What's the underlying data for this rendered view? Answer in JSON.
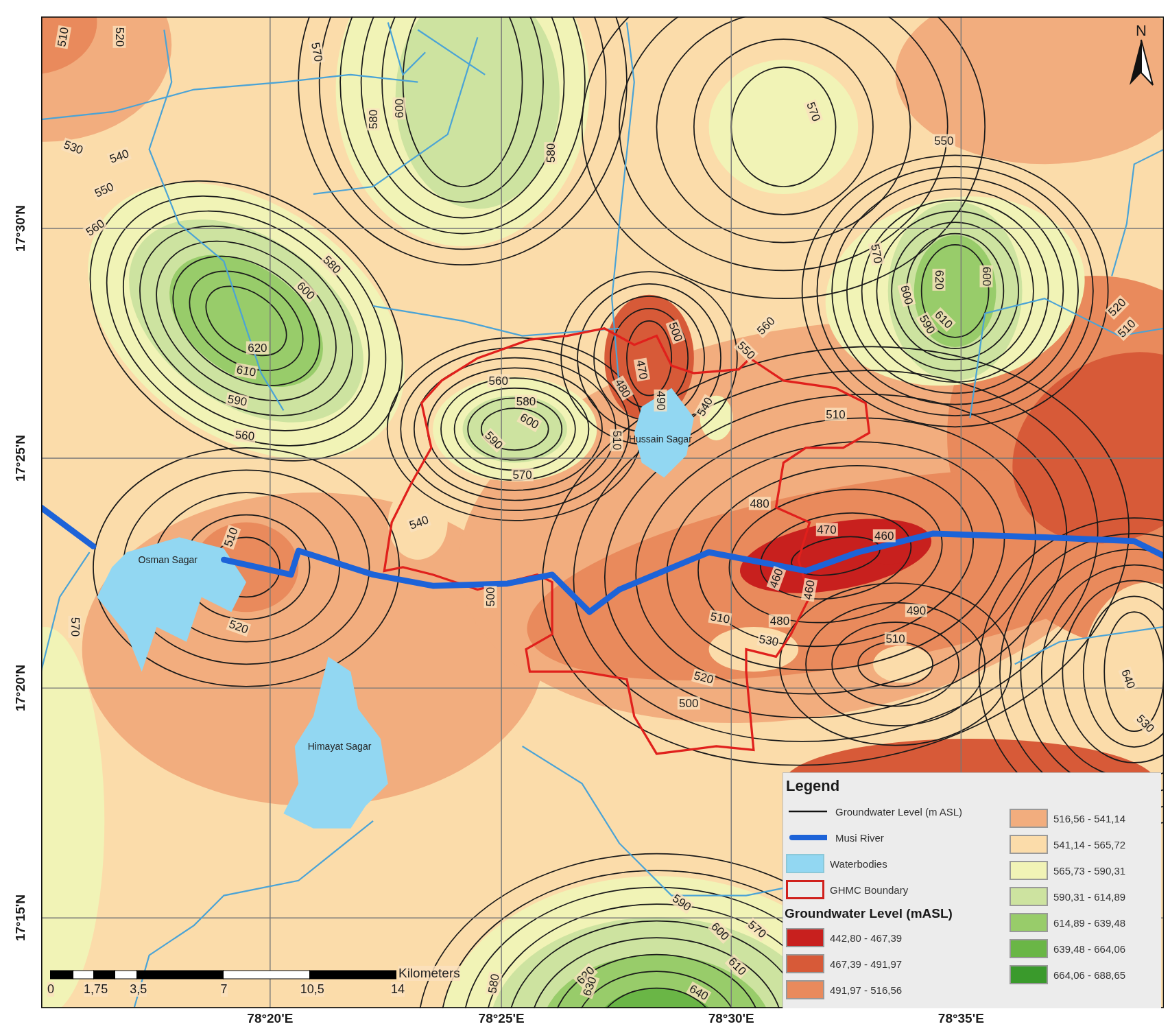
{
  "map": {
    "lat_labels": [
      "17°30'N",
      "17°25'N",
      "17°20'N",
      "17°15'N"
    ],
    "lon_labels": [
      "78°20'E",
      "78°25'E",
      "78°30'E",
      "78°35'E"
    ],
    "contour_labels": [
      "510",
      "520",
      "570",
      "600",
      "580",
      "580",
      "570",
      "550",
      "530",
      "540",
      "550",
      "560",
      "580",
      "600",
      "620",
      "610",
      "590",
      "560",
      "570",
      "620",
      "600",
      "590",
      "610",
      "600",
      "520",
      "510",
      "500",
      "560",
      "550",
      "470",
      "480",
      "490",
      "540",
      "510",
      "560",
      "580",
      "600",
      "590",
      "570",
      "510",
      "480",
      "470",
      "460",
      "460",
      "460",
      "510",
      "480",
      "490",
      "510",
      "530",
      "520",
      "500",
      "640",
      "530",
      "540",
      "510",
      "520",
      "570",
      "500",
      "590",
      "570",
      "600",
      "610",
      "620",
      "630",
      "640",
      "580"
    ],
    "place_labels": [
      "Osman Sagar",
      "Himayat Sagar",
      "Hussain Sagar"
    ],
    "north_arrow": {
      "label": "N"
    },
    "scale_bar": {
      "ticks": [
        "0",
        "1,75",
        "3,5",
        "7",
        "10,5",
        "14"
      ],
      "unit": "Kilometers"
    }
  },
  "legend": {
    "title": "Legend",
    "symbols": [
      {
        "kind": "line",
        "label": "Groundwater Level (m ASL)"
      },
      {
        "kind": "river",
        "label": "Musi River"
      },
      {
        "kind": "water",
        "label": "Waterbodies"
      },
      {
        "kind": "boundary",
        "label": "GHMC Boundary"
      }
    ],
    "classes_title": "Groundwater Level (mASL)",
    "classes": [
      {
        "label": "442,80 - 467,39",
        "color": "#c8201e"
      },
      {
        "label": "467,39 - 491,97",
        "color": "#d75a38"
      },
      {
        "label": "491,97 - 516,56",
        "color": "#e98a5c"
      },
      {
        "label": "516,56 - 541,14",
        "color": "#f2ad7e"
      },
      {
        "label": "541,14 - 565,72",
        "color": "#fbdcaa"
      },
      {
        "label": "565,73 - 590,31",
        "color": "#f1f3b6"
      },
      {
        "label": "590,31 - 614,89",
        "color": "#cde3a0"
      },
      {
        "label": "614,89 - 639,48",
        "color": "#98cc6a"
      },
      {
        "label": "639,48 - 664,06",
        "color": "#6ab646"
      },
      {
        "label": "664,06 - 688,65",
        "color": "#3a9a2c"
      }
    ]
  }
}
